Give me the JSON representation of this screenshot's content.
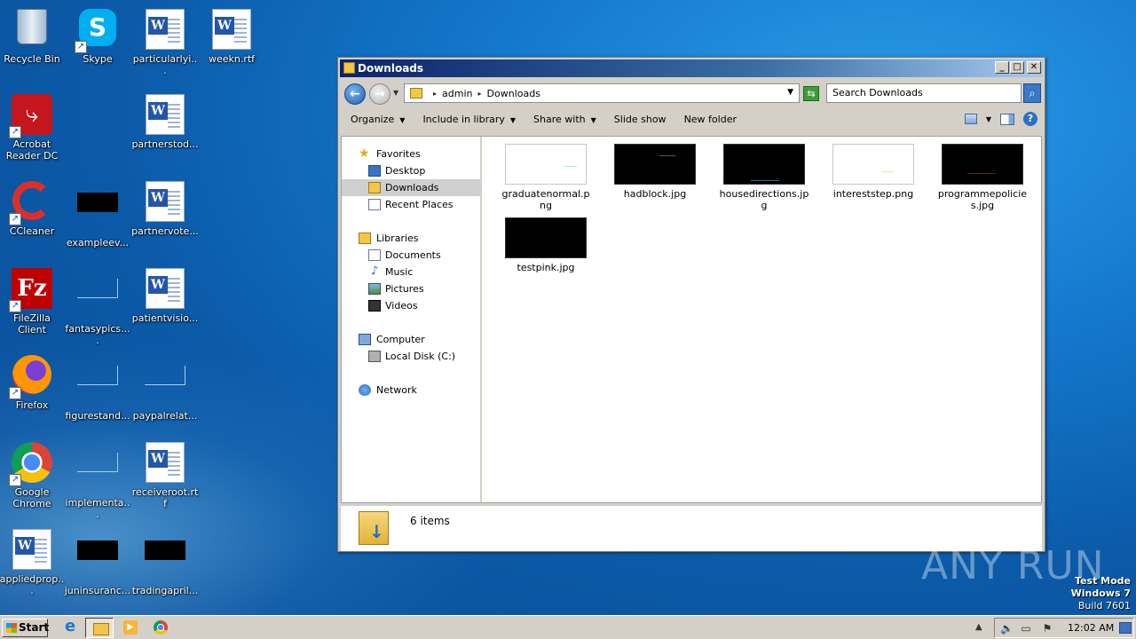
{
  "desktop": {
    "icons": [
      {
        "label": "Recycle Bin",
        "icon": "recycle-bin-icon"
      },
      {
        "label": "Skype",
        "icon": "skype-icon"
      },
      {
        "label": "particularlyi...",
        "icon": "word-doc-icon"
      },
      {
        "label": "weekn.rtf",
        "icon": "word-doc-icon"
      },
      {
        "label": "Acrobat Reader DC",
        "icon": "acrobat-icon"
      },
      {
        "label": "partnerstod...",
        "icon": "word-doc-icon"
      },
      {
        "label": "CCleaner",
        "icon": "ccleaner-icon"
      },
      {
        "label": "exampleev...",
        "icon": "black-thumbnail-icon"
      },
      {
        "label": "partnervote...",
        "icon": "word-doc-icon"
      },
      {
        "label": "FileZilla Client",
        "icon": "filezilla-icon"
      },
      {
        "label": "fantasypics....",
        "icon": "blank-thumbnail-icon"
      },
      {
        "label": "patientvisio...",
        "icon": "word-doc-icon"
      },
      {
        "label": "Firefox",
        "icon": "firefox-icon"
      },
      {
        "label": "figurestand...",
        "icon": "blank-thumbnail-icon"
      },
      {
        "label": "paypalrelat...",
        "icon": "blank-thumbnail-icon"
      },
      {
        "label": "Google Chrome",
        "icon": "chrome-icon"
      },
      {
        "label": "implementa...",
        "icon": "blank-thumbnail-icon"
      },
      {
        "label": "receiveroot.rtf",
        "icon": "word-doc-icon"
      },
      {
        "label": "appliedprop...",
        "icon": "word-doc-icon"
      },
      {
        "label": "juninsuranc...",
        "icon": "black-thumbnail-icon"
      },
      {
        "label": "tradingapril...",
        "icon": "black-thumbnail-icon"
      }
    ]
  },
  "window": {
    "title": "Downloads",
    "breadcrumb": [
      "admin",
      "Downloads"
    ],
    "search_placeholder": "Search Downloads",
    "toolbar": {
      "organize": "Organize",
      "include_in_library": "Include in library",
      "share_with": "Share with",
      "slide_show": "Slide show",
      "new_folder": "New folder"
    },
    "nav": {
      "favorites": "Favorites",
      "desktop": "Desktop",
      "downloads": "Downloads",
      "recent_places": "Recent Places",
      "libraries": "Libraries",
      "documents": "Documents",
      "music": "Music",
      "pictures": "Pictures",
      "videos": "Videos",
      "computer": "Computer",
      "local_disk": "Local Disk (C:)",
      "network": "Network"
    },
    "files": [
      {
        "name": "graduatenormal.png",
        "thumb": "white"
      },
      {
        "name": "hadblock.jpg",
        "thumb": "black"
      },
      {
        "name": "housedirections.jpg",
        "thumb": "black"
      },
      {
        "name": "intereststep.png",
        "thumb": "white"
      },
      {
        "name": "programmepolicies.jpg",
        "thumb": "black"
      },
      {
        "name": "testpink.jpg",
        "thumb": "black"
      }
    ],
    "status": "6 items"
  },
  "watermark": {
    "brand": "ANY RUN",
    "test_mode": "Test Mode",
    "os": "Windows 7",
    "build": "Build 7601"
  },
  "taskbar": {
    "start": "Start",
    "clock": "12:02 AM"
  }
}
